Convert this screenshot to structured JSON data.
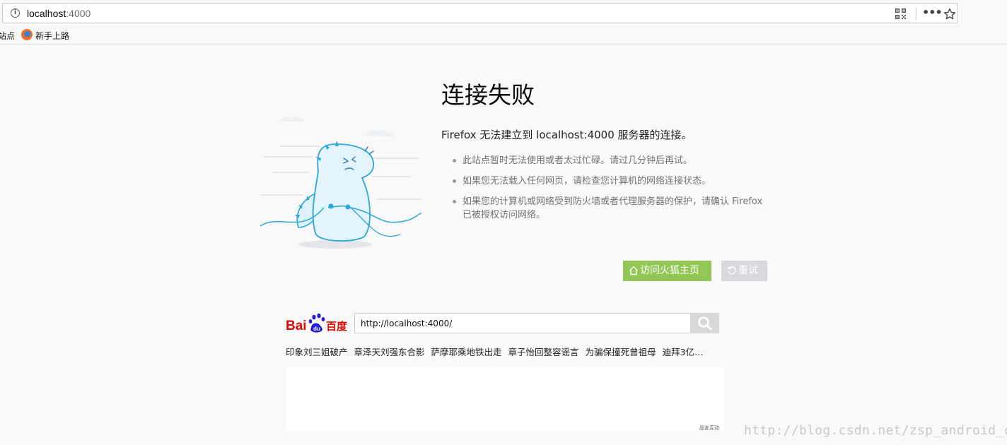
{
  "browser": {
    "url_host": "localhost",
    "url_port": ":4000",
    "icons": {
      "info": "info-icon",
      "qr": "qr-code-icon",
      "more": "more-icon",
      "star": "bookmark-star-icon"
    },
    "bookmarks": [
      {
        "label": "站点"
      },
      {
        "label": "新手上路",
        "icon": "firefox-icon"
      }
    ]
  },
  "error_page": {
    "title": "连接失败",
    "description": "Firefox 无法建立到 localhost:4000 服务器的连接。",
    "tips": [
      "此站点暂时无法使用或者太过忙碌。请过几分钟后再试。",
      "如果您无法载入任何网页，请检查您计算机的网络连接状态。",
      "如果您的计算机或网络受到防火墙或者代理服务器的保护，请确认 Firefox 已被授权访问网络。"
    ],
    "home_button": "访问火狐主页",
    "retry_button": "重试",
    "accent_color": "#93c755"
  },
  "baidu": {
    "search_value": "http://localhost:4000/",
    "hot_searches": [
      "印象刘三姐破产",
      "章泽天刘强东合影",
      "萨摩耶乘地铁出走",
      "章子怡回整容谣言",
      "为骗保撞死曾祖母",
      "迪拜3亿…"
    ],
    "ad_label": "品友互动"
  },
  "watermark": "http://blog.csdn.net/zsp_android_com"
}
